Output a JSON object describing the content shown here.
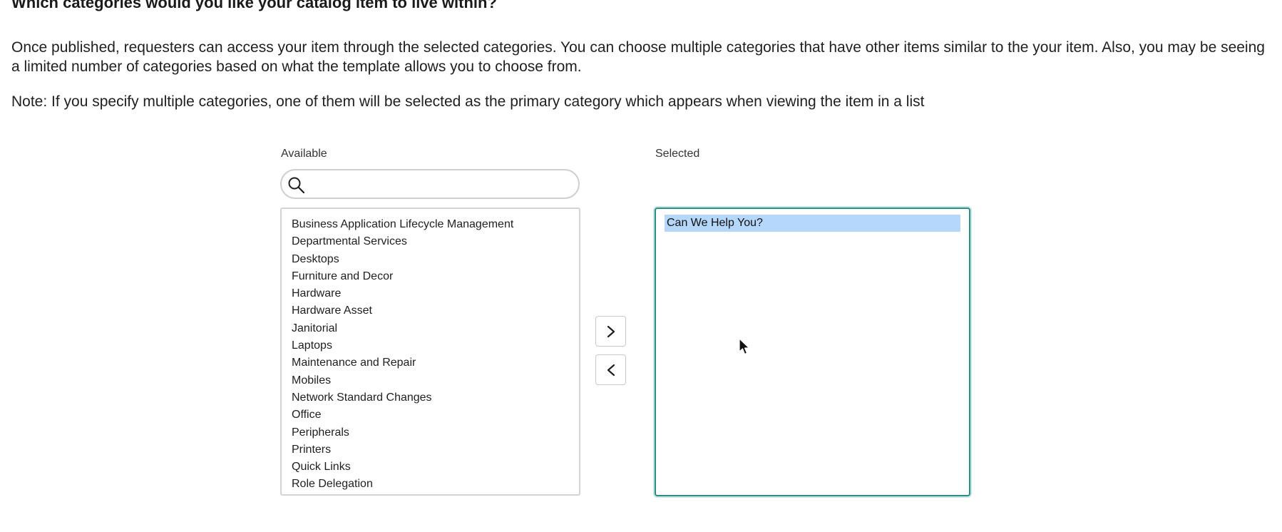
{
  "heading": "Which categories would you like your catalog item to live within?",
  "description": "Once published, requesters can access your item through the selected categories. You can choose multiple categories that have other items similar to the your item. Also, you may be seeing a limited number of categories based on what the template allows you to choose from.",
  "note": "Note: If you specify multiple categories, one of them will be selected as the primary category which appears when viewing the item in a list",
  "available": {
    "label": "Available",
    "search": {
      "value": "",
      "placeholder": ""
    },
    "items": [
      "Business Application Lifecycle Management",
      "Departmental Services",
      "Desktops",
      "Furniture and Decor",
      "Hardware",
      "Hardware Asset",
      "Janitorial",
      "Laptops",
      "Maintenance and Repair",
      "Mobiles",
      "Network Standard Changes",
      "Office",
      "Peripherals",
      "Printers",
      "Quick Links",
      "Role Delegation"
    ]
  },
  "selected": {
    "label": "Selected",
    "items": [
      "Can We Help You?"
    ],
    "highlighted_index": 0
  },
  "buttons": {
    "move_right_icon": "chevron-right-icon",
    "move_left_icon": "chevron-left-icon"
  },
  "colors": {
    "selected_border": "#2f8c86",
    "selected_highlight": "#b5d7fb"
  }
}
